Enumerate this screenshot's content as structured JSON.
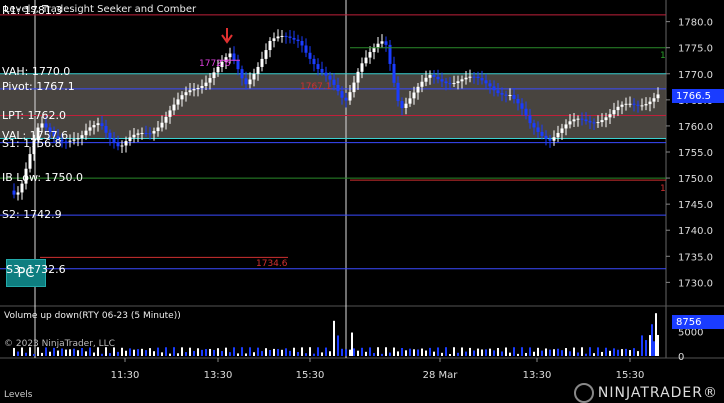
{
  "window": {
    "header_title": "Levels, Tradesight Seeker and Comber",
    "tab_name": "Levels",
    "copyright": "© 2023 NinjaTrader, LLC",
    "logo_text": "NINJATRADER®"
  },
  "price_panel": {
    "ylim": [
      1727,
      1783
    ],
    "y_ticks": [
      "1780.0",
      "1775.0",
      "1770.0",
      "1765.0",
      "1760.0",
      "1755.0",
      "1750.0",
      "1745.0",
      "1740.0",
      "1735.0",
      "1730.0"
    ],
    "last_price": "1766.5",
    "levels": [
      {
        "name": "R1",
        "label": "R1: 1781.3",
        "value": 1781.3,
        "color": "#c0203a"
      },
      {
        "name": "VAH",
        "label": "VAH: 1770.0",
        "value": 1770.0,
        "color": "#3ad0d0"
      },
      {
        "name": "Pivot",
        "label": "Pivot: 1767.1",
        "value": 1767.1,
        "color": "#3a4aff"
      },
      {
        "name": "LPT",
        "label": "LPT: 1762.0",
        "value": 1762.0,
        "color": "#c0203a"
      },
      {
        "name": "VAL",
        "label": "VAL: 1757.6",
        "value": 1757.6,
        "color": "#3ad0d0"
      },
      {
        "name": "S1",
        "label": "S1: 1756.8",
        "value": 1756.8,
        "color": "#3a4aff"
      },
      {
        "name": "IB",
        "label": "IB Low: 1750.0",
        "value": 1750.0,
        "color": "#2a8a2a"
      },
      {
        "name": "S2",
        "label": "S2: 1742.9",
        "value": 1742.9,
        "color": "#3a4aff"
      },
      {
        "name": "S3",
        "label": "S3: 1732.6",
        "value": 1732.6,
        "color": "#3a4aff"
      }
    ],
    "annotations": [
      {
        "text": "1772.6",
        "price": 1772.6,
        "color": "#e040e0"
      },
      {
        "text": "1767.1",
        "price": 1767.1,
        "color": "#d03030"
      },
      {
        "text": "1734.6",
        "price": 1734.6,
        "color": "#d03030"
      },
      {
        "text": "1",
        "price": 1775.0,
        "color": "#2aa02a"
      },
      {
        "text": "1",
        "price": 1749.6,
        "color": "#d03030"
      }
    ]
  },
  "volume_panel": {
    "title": "Volume up down(RTY 06-23 (5 Minute))",
    "y_ticks": [
      "5000",
      "0"
    ],
    "last_volume": "8756"
  },
  "x_axis": {
    "ticks": [
      "11:30",
      "13:30",
      "15:30",
      "28 Mar",
      "13:30",
      "15:30"
    ]
  },
  "buttons": {
    "pc_label": "PC"
  },
  "colors": {
    "up_bar": "#ffffff",
    "down_bar": "#1a3cff",
    "value_area": "#55504a",
    "grid": "#1e1e1e"
  }
}
